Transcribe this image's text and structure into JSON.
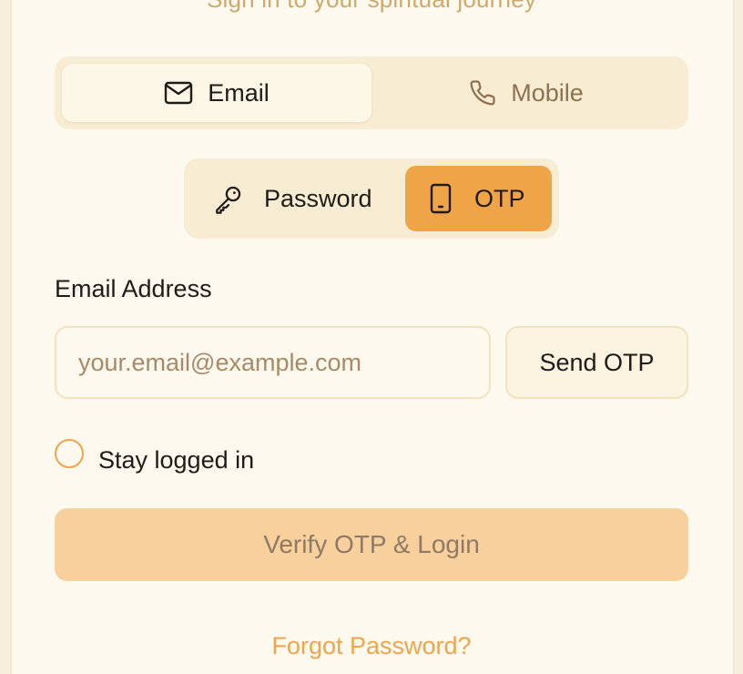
{
  "header": {
    "subtitle": "Sign in to your spiritual journey"
  },
  "method_tabs": {
    "email": {
      "label": "Email",
      "icon": "mail-icon",
      "selected": true
    },
    "mobile": {
      "label": "Mobile",
      "icon": "phone-icon",
      "selected": false
    }
  },
  "auth_tabs": {
    "password": {
      "label": "Password",
      "icon": "key-icon",
      "selected": false
    },
    "otp": {
      "label": "OTP",
      "icon": "smartphone-icon",
      "selected": true
    }
  },
  "form": {
    "email_label": "Email Address",
    "email_value": "",
    "email_placeholder": "your.email@example.com",
    "send_otp_label": "Send OTP",
    "stay_logged_in_label": "Stay logged in",
    "stay_logged_in_checked": false,
    "verify_label": "Verify OTP & Login",
    "forgot_label": "Forgot Password?"
  },
  "colors": {
    "accent": "#f0a448",
    "background": "#fdf9ef",
    "segment_bg": "#f8edd2",
    "disabled_button": "#f7d09c"
  }
}
